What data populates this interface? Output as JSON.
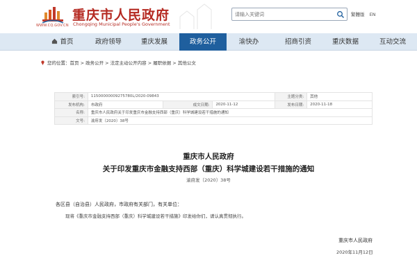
{
  "header": {
    "title": "重庆市人民政府",
    "subtitle": "Chongqing Municipal People's Government",
    "url": "WWW.CQ.GOV.CN",
    "search_placeholder": "请输入关键词",
    "links": [
      "繁體版",
      "EN"
    ]
  },
  "nav": {
    "items": [
      {
        "label": "首页",
        "icon": "home-icon"
      },
      {
        "label": "政府领导"
      },
      {
        "label": "重庆发展"
      },
      {
        "label": "政务公开",
        "active": true
      },
      {
        "label": "渝快办"
      },
      {
        "label": "招商引资"
      },
      {
        "label": "重庆数据"
      },
      {
        "label": "互动交流"
      }
    ]
  },
  "breadcrumb": {
    "label": "您的位置：",
    "path": "首页 > 政务公开 > 法定主动公开内容 > 履职依据 > 其他公文"
  },
  "info": {
    "rows": [
      [
        {
          "k": "索引号:",
          "v": "11500000009275780L/2020-09843"
        },
        {
          "k": "主题分类:",
          "v": "其他"
        }
      ],
      [
        {
          "k": "发布机构:",
          "v": "市政府"
        },
        {
          "k": "成文日期:",
          "v": "2020-11-12"
        },
        {
          "k": "发布日期:",
          "v": "2020-11-18"
        }
      ],
      [
        {
          "k": "名称:",
          "v": "重庆市人民政府关于印发重庆市金融支持西部（重庆）科学城建设若干措施的通知"
        }
      ],
      [
        {
          "k": "文号:",
          "v": "渝府发〔2020〕38号"
        }
      ]
    ]
  },
  "document": {
    "org": "重庆市人民政府",
    "title": "关于印发重庆市金融支持西部（重庆）科学城建设若干措施的通知",
    "number": "渝府发〔2020〕38号",
    "salutation": "各区县（自治县）人民政府，市政府有关部门，有关单位：",
    "body": "现将《重庆市金融支持西部（重庆）科学城建设若干措施》印发给你们，请认真贯彻执行。",
    "signature": "重庆市人民政府",
    "date": "2020年11月12日"
  },
  "colors": {
    "brand_red": "#b52a22",
    "nav_active": "#1f5f9e",
    "nav_bg": "#dde8f3"
  }
}
